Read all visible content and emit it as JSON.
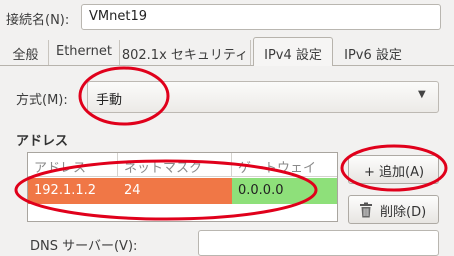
{
  "connection": {
    "label": "接続名(N):",
    "value": "VMnet19"
  },
  "tabs": [
    {
      "label": "全般",
      "active": false
    },
    {
      "label": "Ethernet",
      "active": false
    },
    {
      "label": "802.1x セキュリティ",
      "active": false
    },
    {
      "label": "IPv4 設定",
      "active": true
    },
    {
      "label": "IPv6 設定",
      "active": false
    }
  ],
  "method": {
    "label": "方式(M):",
    "value": "手動",
    "arrow_icon": "triangle-down"
  },
  "addresses": {
    "heading": "アドレス",
    "columns": [
      "アドレス",
      "ネットマスク",
      "ゲートウェイ"
    ],
    "rows": [
      {
        "address": "192.1.1.2",
        "netmask": "24",
        "gateway": "0.0.0.0"
      }
    ],
    "add_button": "+ 追加(A)",
    "delete_button": "削除(D)"
  },
  "dns": {
    "label": "DNS サーバー(V):",
    "value": ""
  },
  "colors": {
    "selection": "#f07746",
    "edit_cell": "#8ee07a",
    "annotation": "#e0001b"
  }
}
